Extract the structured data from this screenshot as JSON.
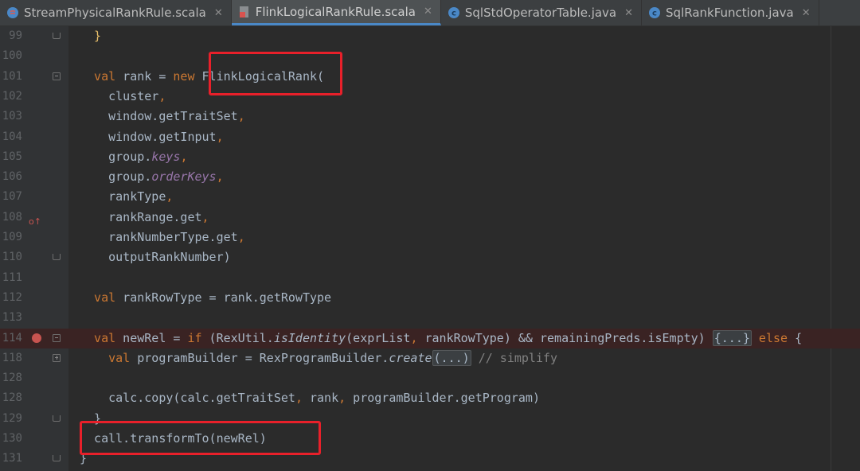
{
  "tabs": [
    {
      "label": "StreamPhysicalRankRule.scala",
      "icon": "scala-object-icon",
      "active": false
    },
    {
      "label": "FlinkLogicalRankRule.scala",
      "icon": "scala-file-icon",
      "active": true
    },
    {
      "label": "SqlStdOperatorTable.java",
      "icon": "java-class-icon",
      "active": false
    },
    {
      "label": "SqlRankFunction.java",
      "icon": "java-class-icon",
      "active": false
    }
  ],
  "tab_close_glyph": "✕",
  "lines": [
    {
      "num": "99",
      "parts": [
        {
          "t": "  }",
          "c": "brace"
        }
      ]
    },
    {
      "num": "100",
      "parts": []
    },
    {
      "num": "101",
      "parts": [
        {
          "t": "  val",
          "c": "kw"
        },
        {
          "t": " rank = "
        },
        {
          "t": "new",
          "c": "kw"
        },
        {
          "t": " FlinkLogicalRank("
        }
      ]
    },
    {
      "num": "102",
      "parts": [
        {
          "t": "    cluster"
        },
        {
          "t": ",",
          "c": "kw"
        }
      ]
    },
    {
      "num": "103",
      "parts": [
        {
          "t": "    window.getTraitSet"
        },
        {
          "t": ",",
          "c": "kw"
        }
      ]
    },
    {
      "num": "104",
      "parts": [
        {
          "t": "    window.getInput"
        },
        {
          "t": ",",
          "c": "kw"
        }
      ]
    },
    {
      "num": "105",
      "parts": [
        {
          "t": "    group."
        },
        {
          "t": "keys",
          "c": "fld"
        },
        {
          "t": ",",
          "c": "kw"
        }
      ]
    },
    {
      "num": "106",
      "parts": [
        {
          "t": "    group."
        },
        {
          "t": "orderKeys",
          "c": "fld"
        },
        {
          "t": ",",
          "c": "kw"
        }
      ]
    },
    {
      "num": "107",
      "parts": [
        {
          "t": "    rankType"
        },
        {
          "t": ",",
          "c": "kw"
        }
      ]
    },
    {
      "num": "108",
      "parts": [
        {
          "t": "    rankRange.get"
        },
        {
          "t": ",",
          "c": "kw"
        }
      ]
    },
    {
      "num": "109",
      "parts": [
        {
          "t": "    rankNumberType.get"
        },
        {
          "t": ",",
          "c": "kw"
        }
      ]
    },
    {
      "num": "110",
      "parts": [
        {
          "t": "    outputRankNumber)"
        }
      ]
    },
    {
      "num": "111",
      "parts": []
    },
    {
      "num": "112",
      "parts": [
        {
          "t": "  val",
          "c": "kw"
        },
        {
          "t": " rankRowType = rank.getRowType"
        }
      ]
    },
    {
      "num": "113",
      "parts": []
    },
    {
      "num": "114",
      "parts": [
        {
          "t": "  val",
          "c": "kw"
        },
        {
          "t": " newRel = "
        },
        {
          "t": "if",
          "c": "kw"
        },
        {
          "t": " (RexUtil."
        },
        {
          "t": "isIdentity",
          "c": "it"
        },
        {
          "t": "(exprList"
        },
        {
          "t": ",",
          "c": "kw"
        },
        {
          "t": " rankRowType) && remainingPreds.isEmpty) "
        },
        {
          "t": "{...}",
          "c": "folded"
        },
        {
          "t": " "
        },
        {
          "t": "else",
          "c": "kw"
        },
        {
          "t": " {"
        }
      ]
    },
    {
      "num": "118",
      "parts": [
        {
          "t": "    val",
          "c": "kw"
        },
        {
          "t": " programBuilder = RexProgramBuilder."
        },
        {
          "t": "create",
          "c": "it"
        },
        {
          "t": "(...)",
          "c": "folded"
        },
        {
          "t": " "
        },
        {
          "t": "// simplify",
          "c": "cm"
        }
      ]
    },
    {
      "num": "128",
      "parts": []
    },
    {
      "num": "128",
      "parts": [
        {
          "t": "    calc.copy(calc.getTraitSet"
        },
        {
          "t": ",",
          "c": "kw"
        },
        {
          "t": " rank"
        },
        {
          "t": ",",
          "c": "kw"
        },
        {
          "t": " programBuilder.getProgram)"
        }
      ]
    },
    {
      "num": "129",
      "parts": [
        {
          "t": "  }"
        }
      ]
    },
    {
      "num": "130",
      "parts": [
        {
          "t": "  call.transformTo(newRel)"
        }
      ]
    },
    {
      "num": "131",
      "parts": [
        {
          "t": "}"
        }
      ]
    }
  ],
  "line_markers": {
    "101": "fold-open",
    "110": "fold-end",
    "114": "breakpoint",
    "118": "fold-collapsed",
    "129": "fold-end",
    "131": "fold-end",
    "99": "fold-end",
    "108": "override-marker"
  },
  "override_glyph": "o↑",
  "colors": {
    "keyword": "#cc7832",
    "text": "#a9b7c6",
    "field": "#9876aa",
    "comment": "#808080",
    "highlight_box": "#e8202a",
    "breakpoint": "#c75450"
  }
}
